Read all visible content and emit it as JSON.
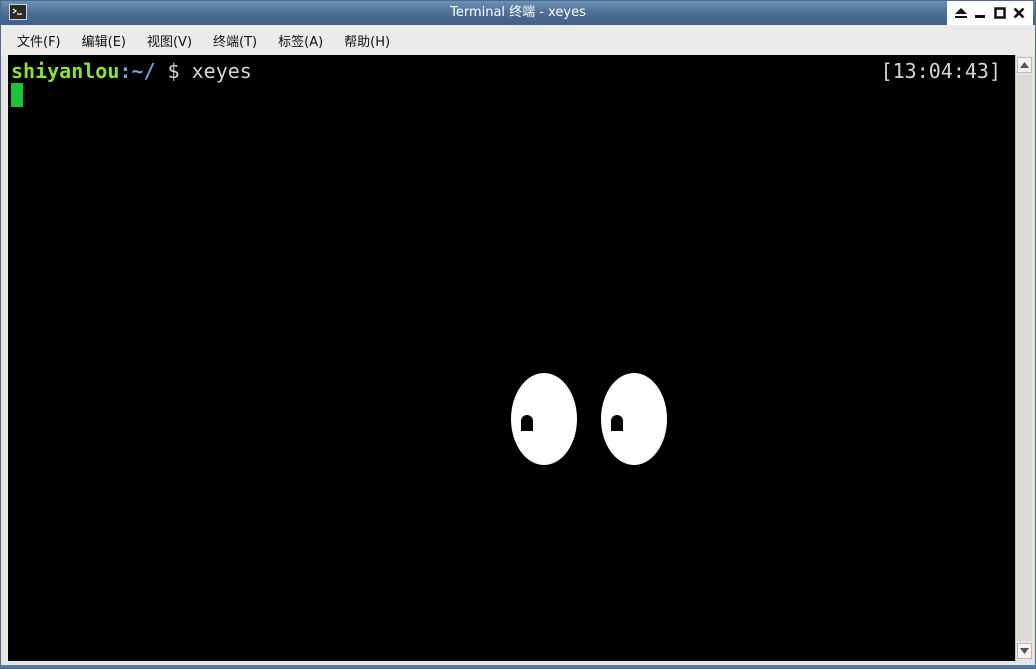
{
  "window": {
    "title": "Terminal 终端 - xeyes"
  },
  "icons": {
    "app": "terminal-app-icon",
    "shade": "shade-icon",
    "minimize": "minimize-icon",
    "maximize": "maximize-icon",
    "close": "close-icon",
    "scroll_up": "scroll-up-arrow-icon",
    "scroll_down": "scroll-down-arrow-icon"
  },
  "menubar": {
    "items": [
      {
        "label": "文件(F)"
      },
      {
        "label": "编辑(E)"
      },
      {
        "label": "视图(V)"
      },
      {
        "label": "终端(T)"
      },
      {
        "label": "标签(A)"
      },
      {
        "label": "帮助(H)"
      }
    ]
  },
  "terminal": {
    "prompt_user": "shiyanlou",
    "prompt_sep": ":",
    "prompt_path": "~/",
    "prompt_symbol": " $ ",
    "command": "xeyes",
    "clock": "[13:04:43]",
    "colors": {
      "background": "#000000",
      "user": "#8ae234",
      "path": "#729fcf",
      "text": "#d3d7cf",
      "cursor": "#19c43a"
    }
  },
  "colors": {
    "titlebar": "#4d6f96",
    "menubar": "#edebe9"
  }
}
